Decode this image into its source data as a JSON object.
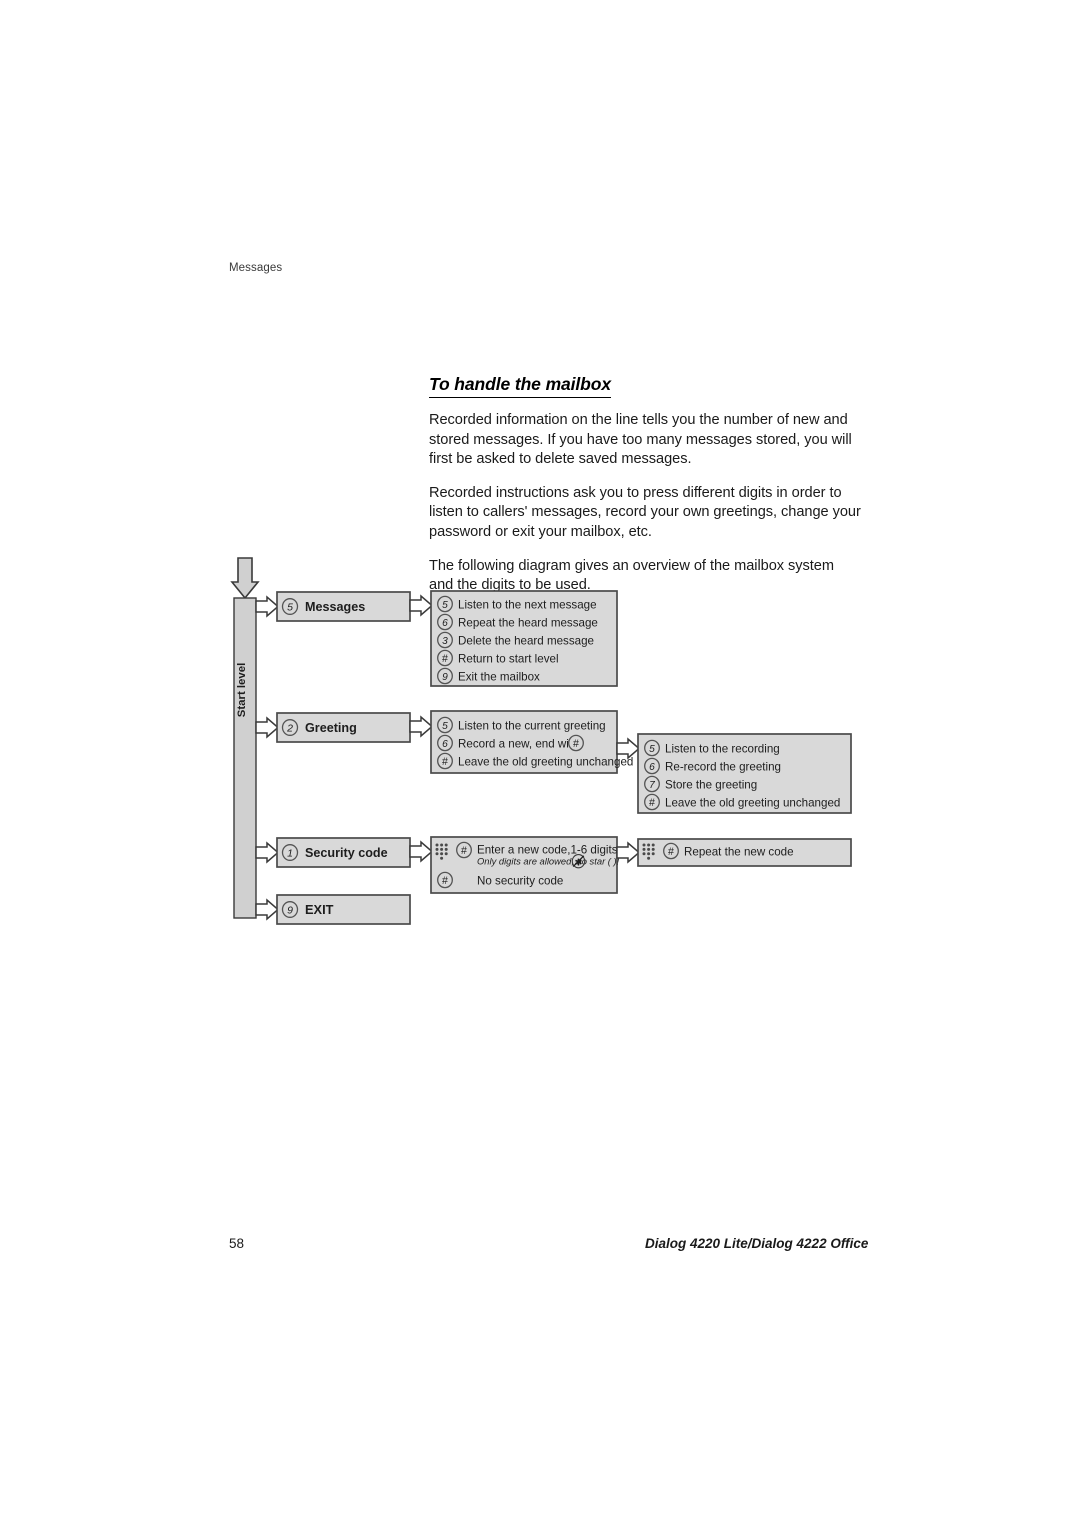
{
  "running_head": "Messages",
  "heading": "To handle the mailbox",
  "paragraphs": [
    "Recorded information on the line tells you the number of new and stored messages. If you have too many messages stored, you will first be asked to delete saved messages.",
    "Recorded instructions ask you to press different digits in order to listen to callers' messages, record your own greetings, change your password or exit your mailbox, etc.",
    "The following diagram gives an overview of the mailbox system and the digits to be used."
  ],
  "footer": {
    "page_number": "58",
    "title": "Dialog 4220 Lite/Dialog 4222 Office"
  },
  "diagram": {
    "start_level_label": "Start level",
    "menu_items": [
      {
        "key": "5",
        "label": "Messages"
      },
      {
        "key": "2",
        "label": "Greeting"
      },
      {
        "key": "1",
        "label": "Security  code"
      },
      {
        "key": "9",
        "label": "EXIT"
      }
    ],
    "messages_options": [
      {
        "key": "5",
        "text": "Listen to the next message"
      },
      {
        "key": "6",
        "text": "Repeat the heard message"
      },
      {
        "key": "3",
        "text": "Delete the heard message"
      },
      {
        "key": "#",
        "text": "Return to start level"
      },
      {
        "key": "9",
        "text": "Exit the mailbox"
      }
    ],
    "greeting_options": [
      {
        "key": "5",
        "text": "Listen to the current greeting"
      },
      {
        "key": "6",
        "text": "Record a new, end with",
        "trailing_key": "#"
      },
      {
        "key": "#",
        "text": "Leave the old greeting unchanged"
      }
    ],
    "greeting_recording_options": [
      {
        "key": "5",
        "text": "Listen to the recording"
      },
      {
        "key": "6",
        "text": "Re-record the greeting"
      },
      {
        "key": "7",
        "text": "Store the greeting"
      },
      {
        "key": "#",
        "text": "Leave the old greeting unchanged"
      }
    ],
    "security_options": [
      {
        "key": "#",
        "text": "Enter a new code,1-6 digits",
        "note": "Only digits are allowed, no star (   )!",
        "keypad": true
      },
      {
        "key": "#",
        "text": "No security code",
        "keypad": false
      }
    ],
    "security_repeat_options": [
      {
        "key": "#",
        "text": "Repeat the new code",
        "keypad": true
      }
    ],
    "colors": {
      "box_fill": "#d9d9d9",
      "box_stroke": "#4a4a4a",
      "bar_fill": "#d0d0d0",
      "arrow_fill": "#ffffff",
      "text": "#1d1d1d"
    }
  }
}
